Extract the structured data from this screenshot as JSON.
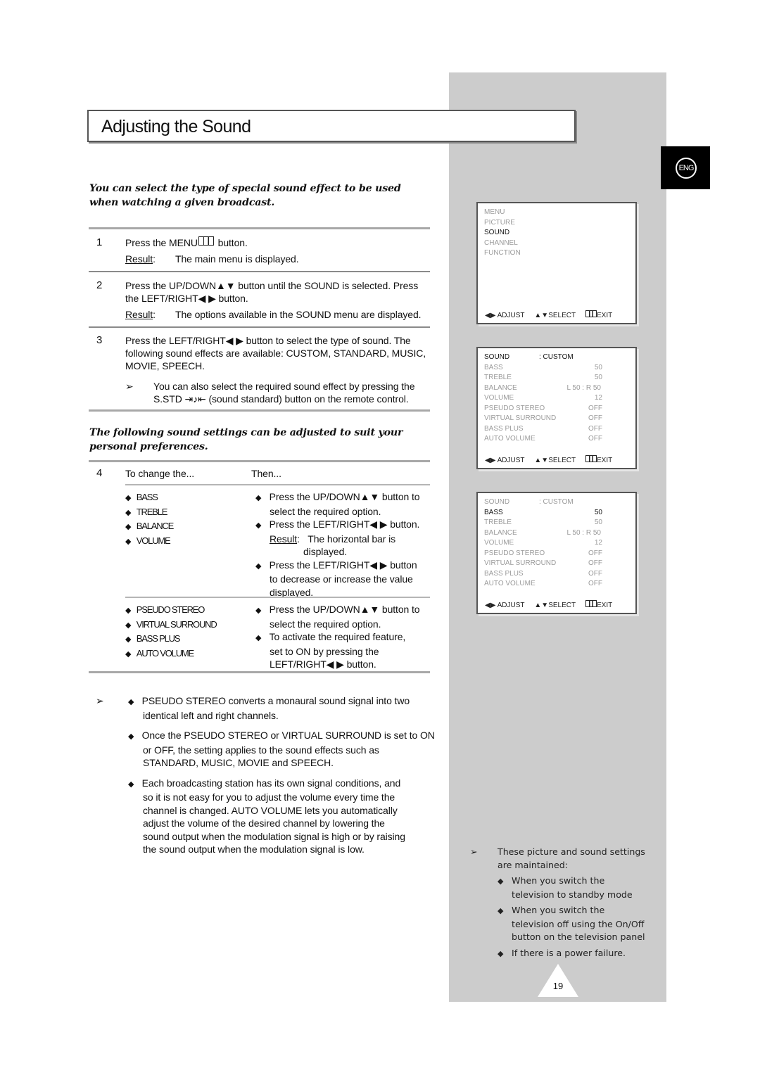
{
  "page": {
    "title": "Adjusting the Sound",
    "language_badge": "ENG",
    "page_number": "19",
    "intro": "You can select the type of special sound effect to be used when watching a given broadcast.",
    "intro2": "The following sound settings can be adjusted to suit your personal preferences."
  },
  "steps": [
    {
      "num": "1",
      "line1_pre": "Press the MENU",
      "line1_icon": "menu-icon",
      "line1_post": " button.",
      "result_label": "Result",
      "result_text": "The main menu is displayed."
    },
    {
      "num": "2",
      "line1": "Press the UP/DOWN▲▼ button until the SOUND is selected. Press",
      "line2": "the LEFT/RIGHT◀ ▶ button.",
      "result_label": "Result",
      "result_text": "The options available in the SOUND menu are displayed."
    },
    {
      "num": "3",
      "line1": "Press the LEFT/RIGHT◀ ▶ button to select the type of sound. The",
      "line2": "following sound effects are available: CUSTOM, STANDARD, MUSIC,",
      "line3": "MOVIE, SPEECH.",
      "note1": "You can also select the required sound effect by pressing the",
      "note2": "S.STD ⇥♪⇤ (sound standard) button on the remote control."
    }
  ],
  "step4": {
    "num": "4",
    "col1_header": "To change the...",
    "col2_header": "Then...",
    "group1": {
      "items": [
        "BASS",
        "TREBLE",
        "BALANCE",
        "VOLUME"
      ],
      "instructions": [
        {
          "l1": "Press the UP/DOWN▲▼ button to",
          "l2": "select the required option."
        },
        {
          "l1": "Press the LEFT/RIGHT◀ ▶ button.",
          "result_label": "Result",
          "result_l1": "The horizontal bar is",
          "result_l2": "displayed."
        },
        {
          "l1": "Press the LEFT/RIGHT◀ ▶ button",
          "l2": "to decrease or increase the value",
          "l3": "displayed."
        }
      ]
    },
    "group2": {
      "items": [
        "PSEUDO STEREO",
        "VIRTUAL SURROUND",
        "BASS PLUS",
        "AUTO VOLUME"
      ],
      "instructions": [
        {
          "l1": "Press the UP/DOWN▲▼ button to",
          "l2": "select the required option."
        },
        {
          "l1": "To activate the required feature,",
          "l2": "set to ON by pressing the",
          "l3": "LEFT/RIGHT◀ ▶ button."
        }
      ]
    }
  },
  "notes": [
    {
      "lines": [
        "PSEUDO STEREO converts a monaural sound signal into two",
        "identical left and right channels."
      ]
    },
    {
      "lines": [
        "Once the PSEUDO STEREO or VIRTUAL SURROUND is set to ON",
        "or OFF, the setting applies to the sound effects such as",
        "STANDARD, MUSIC, MOVIE and SPEECH."
      ]
    },
    {
      "lines": [
        "Each broadcasting station has its own signal conditions, and",
        "so it is not easy for you to adjust the volume every time the",
        "channel is changed. AUTO VOLUME lets you automatically",
        "adjust the volume of the desired channel by lowering the",
        "sound output when the modulation signal is high or by raising",
        "the sound output when the modulation signal is low."
      ]
    }
  ],
  "osd_footer": {
    "adjust": "◀▶ ADJUST",
    "select": "▲▼SELECT",
    "exit": "EXIT"
  },
  "osd_main": {
    "items": [
      "MENU",
      "PICTURE",
      "SOUND",
      "CHANNEL",
      "FUNCTION"
    ],
    "selected": "SOUND"
  },
  "osd_sound": {
    "header_label": "SOUND",
    "header_value": ": CUSTOM",
    "rows": [
      {
        "label": "BASS",
        "value": "50"
      },
      {
        "label": "TREBLE",
        "value": "50"
      },
      {
        "label": "BALANCE",
        "value": "L 50 : R 50"
      },
      {
        "label": "VOLUME",
        "value": "12"
      },
      {
        "label": "PSEUDO STEREO",
        "value": "OFF"
      },
      {
        "label": "VIRTUAL SURROUND",
        "value": "OFF"
      },
      {
        "label": "BASS PLUS",
        "value": "OFF"
      },
      {
        "label": "AUTO VOLUME",
        "value": "OFF"
      }
    ]
  },
  "side_note": {
    "intro_l1": "These picture and sound settings",
    "intro_l2": "are maintained:",
    "bullets": [
      {
        "lines": [
          "When you switch the",
          "television to standby mode"
        ]
      },
      {
        "lines": [
          "When you switch the",
          "television off using the On/Off",
          "button on the television panel"
        ]
      },
      {
        "lines": [
          "If there is a power failure."
        ]
      }
    ]
  }
}
